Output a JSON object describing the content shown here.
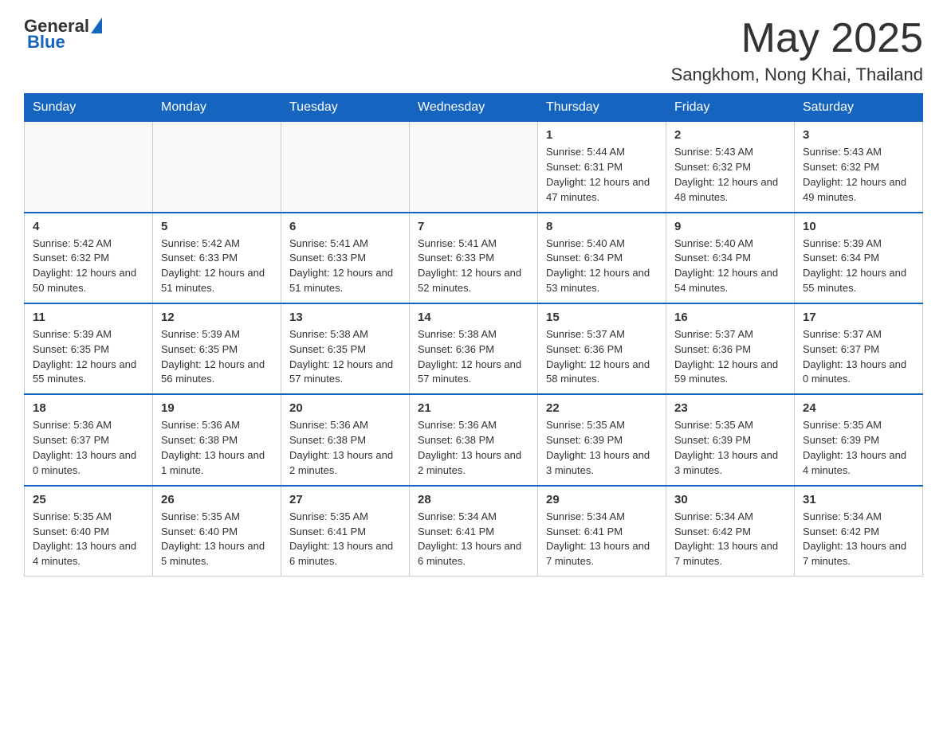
{
  "header": {
    "logo": {
      "text_general": "General",
      "text_blue": "Blue",
      "arrow_symbol": "▲"
    },
    "month_title": "May 2025",
    "location": "Sangkhom, Nong Khai, Thailand"
  },
  "weekdays": [
    "Sunday",
    "Monday",
    "Tuesday",
    "Wednesday",
    "Thursday",
    "Friday",
    "Saturday"
  ],
  "weeks": [
    {
      "days": [
        {
          "number": "",
          "sunrise": "",
          "sunset": "",
          "daylight": ""
        },
        {
          "number": "",
          "sunrise": "",
          "sunset": "",
          "daylight": ""
        },
        {
          "number": "",
          "sunrise": "",
          "sunset": "",
          "daylight": ""
        },
        {
          "number": "",
          "sunrise": "",
          "sunset": "",
          "daylight": ""
        },
        {
          "number": "1",
          "sunrise": "Sunrise: 5:44 AM",
          "sunset": "Sunset: 6:31 PM",
          "daylight": "Daylight: 12 hours and 47 minutes."
        },
        {
          "number": "2",
          "sunrise": "Sunrise: 5:43 AM",
          "sunset": "Sunset: 6:32 PM",
          "daylight": "Daylight: 12 hours and 48 minutes."
        },
        {
          "number": "3",
          "sunrise": "Sunrise: 5:43 AM",
          "sunset": "Sunset: 6:32 PM",
          "daylight": "Daylight: 12 hours and 49 minutes."
        }
      ]
    },
    {
      "days": [
        {
          "number": "4",
          "sunrise": "Sunrise: 5:42 AM",
          "sunset": "Sunset: 6:32 PM",
          "daylight": "Daylight: 12 hours and 50 minutes."
        },
        {
          "number": "5",
          "sunrise": "Sunrise: 5:42 AM",
          "sunset": "Sunset: 6:33 PM",
          "daylight": "Daylight: 12 hours and 51 minutes."
        },
        {
          "number": "6",
          "sunrise": "Sunrise: 5:41 AM",
          "sunset": "Sunset: 6:33 PM",
          "daylight": "Daylight: 12 hours and 51 minutes."
        },
        {
          "number": "7",
          "sunrise": "Sunrise: 5:41 AM",
          "sunset": "Sunset: 6:33 PM",
          "daylight": "Daylight: 12 hours and 52 minutes."
        },
        {
          "number": "8",
          "sunrise": "Sunrise: 5:40 AM",
          "sunset": "Sunset: 6:34 PM",
          "daylight": "Daylight: 12 hours and 53 minutes."
        },
        {
          "number": "9",
          "sunrise": "Sunrise: 5:40 AM",
          "sunset": "Sunset: 6:34 PM",
          "daylight": "Daylight: 12 hours and 54 minutes."
        },
        {
          "number": "10",
          "sunrise": "Sunrise: 5:39 AM",
          "sunset": "Sunset: 6:34 PM",
          "daylight": "Daylight: 12 hours and 55 minutes."
        }
      ]
    },
    {
      "days": [
        {
          "number": "11",
          "sunrise": "Sunrise: 5:39 AM",
          "sunset": "Sunset: 6:35 PM",
          "daylight": "Daylight: 12 hours and 55 minutes."
        },
        {
          "number": "12",
          "sunrise": "Sunrise: 5:39 AM",
          "sunset": "Sunset: 6:35 PM",
          "daylight": "Daylight: 12 hours and 56 minutes."
        },
        {
          "number": "13",
          "sunrise": "Sunrise: 5:38 AM",
          "sunset": "Sunset: 6:35 PM",
          "daylight": "Daylight: 12 hours and 57 minutes."
        },
        {
          "number": "14",
          "sunrise": "Sunrise: 5:38 AM",
          "sunset": "Sunset: 6:36 PM",
          "daylight": "Daylight: 12 hours and 57 minutes."
        },
        {
          "number": "15",
          "sunrise": "Sunrise: 5:37 AM",
          "sunset": "Sunset: 6:36 PM",
          "daylight": "Daylight: 12 hours and 58 minutes."
        },
        {
          "number": "16",
          "sunrise": "Sunrise: 5:37 AM",
          "sunset": "Sunset: 6:36 PM",
          "daylight": "Daylight: 12 hours and 59 minutes."
        },
        {
          "number": "17",
          "sunrise": "Sunrise: 5:37 AM",
          "sunset": "Sunset: 6:37 PM",
          "daylight": "Daylight: 13 hours and 0 minutes."
        }
      ]
    },
    {
      "days": [
        {
          "number": "18",
          "sunrise": "Sunrise: 5:36 AM",
          "sunset": "Sunset: 6:37 PM",
          "daylight": "Daylight: 13 hours and 0 minutes."
        },
        {
          "number": "19",
          "sunrise": "Sunrise: 5:36 AM",
          "sunset": "Sunset: 6:38 PM",
          "daylight": "Daylight: 13 hours and 1 minute."
        },
        {
          "number": "20",
          "sunrise": "Sunrise: 5:36 AM",
          "sunset": "Sunset: 6:38 PM",
          "daylight": "Daylight: 13 hours and 2 minutes."
        },
        {
          "number": "21",
          "sunrise": "Sunrise: 5:36 AM",
          "sunset": "Sunset: 6:38 PM",
          "daylight": "Daylight: 13 hours and 2 minutes."
        },
        {
          "number": "22",
          "sunrise": "Sunrise: 5:35 AM",
          "sunset": "Sunset: 6:39 PM",
          "daylight": "Daylight: 13 hours and 3 minutes."
        },
        {
          "number": "23",
          "sunrise": "Sunrise: 5:35 AM",
          "sunset": "Sunset: 6:39 PM",
          "daylight": "Daylight: 13 hours and 3 minutes."
        },
        {
          "number": "24",
          "sunrise": "Sunrise: 5:35 AM",
          "sunset": "Sunset: 6:39 PM",
          "daylight": "Daylight: 13 hours and 4 minutes."
        }
      ]
    },
    {
      "days": [
        {
          "number": "25",
          "sunrise": "Sunrise: 5:35 AM",
          "sunset": "Sunset: 6:40 PM",
          "daylight": "Daylight: 13 hours and 4 minutes."
        },
        {
          "number": "26",
          "sunrise": "Sunrise: 5:35 AM",
          "sunset": "Sunset: 6:40 PM",
          "daylight": "Daylight: 13 hours and 5 minutes."
        },
        {
          "number": "27",
          "sunrise": "Sunrise: 5:35 AM",
          "sunset": "Sunset: 6:41 PM",
          "daylight": "Daylight: 13 hours and 6 minutes."
        },
        {
          "number": "28",
          "sunrise": "Sunrise: 5:34 AM",
          "sunset": "Sunset: 6:41 PM",
          "daylight": "Daylight: 13 hours and 6 minutes."
        },
        {
          "number": "29",
          "sunrise": "Sunrise: 5:34 AM",
          "sunset": "Sunset: 6:41 PM",
          "daylight": "Daylight: 13 hours and 7 minutes."
        },
        {
          "number": "30",
          "sunrise": "Sunrise: 5:34 AM",
          "sunset": "Sunset: 6:42 PM",
          "daylight": "Daylight: 13 hours and 7 minutes."
        },
        {
          "number": "31",
          "sunrise": "Sunrise: 5:34 AM",
          "sunset": "Sunset: 6:42 PM",
          "daylight": "Daylight: 13 hours and 7 minutes."
        }
      ]
    }
  ]
}
